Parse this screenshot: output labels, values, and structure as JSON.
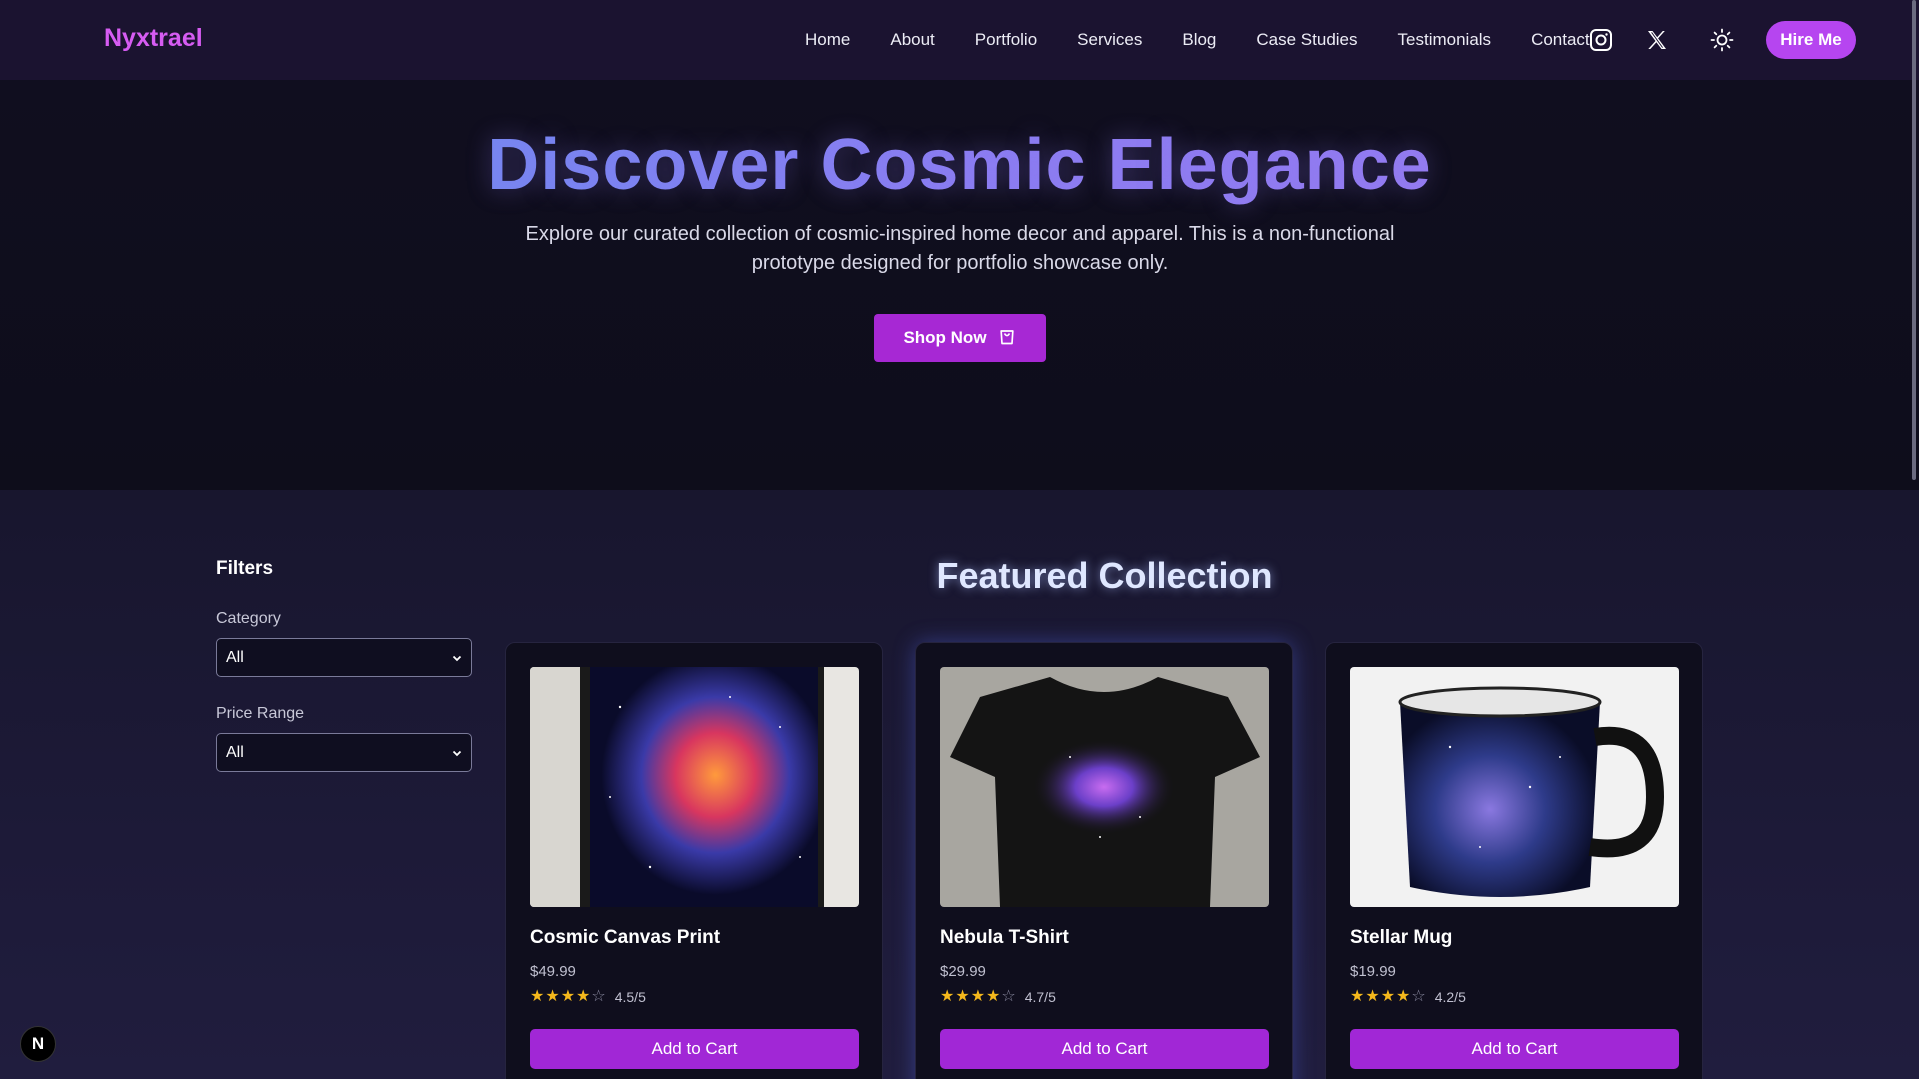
{
  "nav": {
    "logo": "Nyxtrael",
    "links": [
      "Home",
      "About",
      "Portfolio",
      "Services",
      "Blog",
      "Case Studies",
      "Testimonials",
      "Contact"
    ],
    "icons": [
      "instagram-icon",
      "x-twitter-icon",
      "sun-theme-icon"
    ],
    "hire_label": "Hire Me"
  },
  "hero": {
    "title": "Discover Cosmic Elegance",
    "subtitle": "Explore our curated collection of cosmic-inspired home decor and apparel. This is a non-functional prototype designed for portfolio showcase only.",
    "shop_label": "Shop Now"
  },
  "filters": {
    "title": "Filters",
    "category_label": "Category",
    "category_value": "All",
    "price_label": "Price Range",
    "price_value": "All"
  },
  "featured": {
    "title": "Featured Collection",
    "products": [
      {
        "name": "Cosmic Canvas Print",
        "price": "$49.99",
        "rating": "4.5/5",
        "stars": 4,
        "button": "Add to Cart"
      },
      {
        "name": "Nebula T-Shirt",
        "price": "$29.99",
        "rating": "4.7/5",
        "stars": 4,
        "button": "Add to Cart"
      },
      {
        "name": "Stellar Mug",
        "price": "$19.99",
        "rating": "4.2/5",
        "stars": 4,
        "button": "Add to Cart"
      }
    ]
  },
  "dev_badge": "N",
  "colors": {
    "brand": "#d65cf2",
    "accent_button": "#a127d6",
    "star": "#f5b81c",
    "background": "#0f0f1e"
  }
}
